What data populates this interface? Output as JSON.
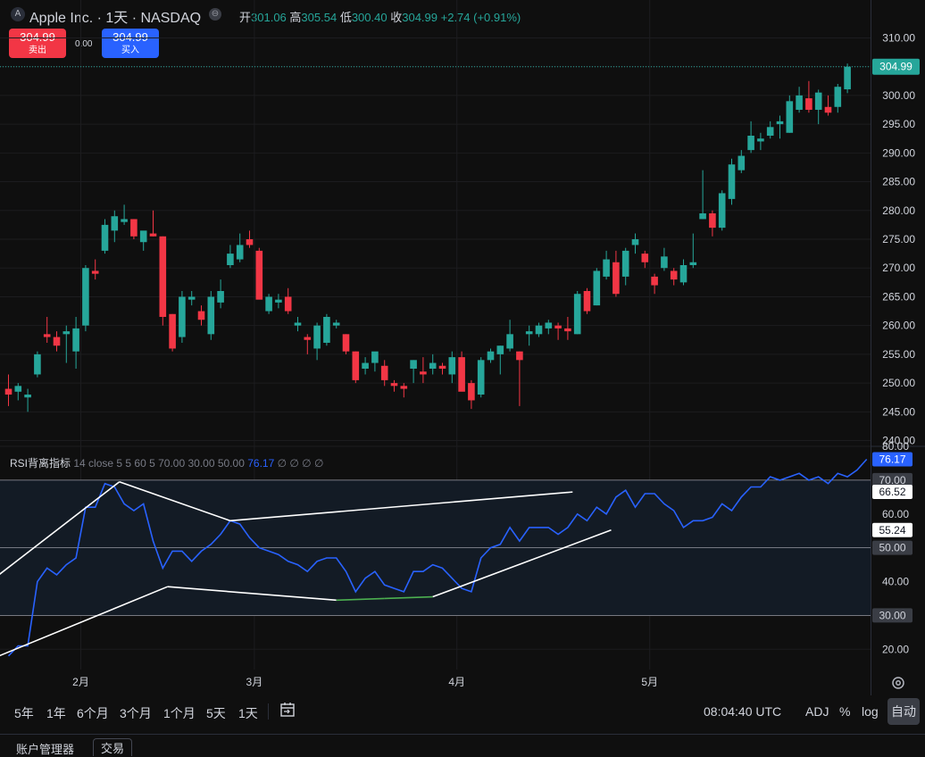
{
  "header": {
    "logo_letter": "A",
    "symbol": "Apple Inc. · 1天 · NASDAQ",
    "open_label": "开",
    "open_value": "301.06",
    "high_label": "高",
    "high_value": "305.54",
    "low_label": "低",
    "low_value": "300.40",
    "close_label": "收",
    "close_value": "304.99",
    "change": "+2.74 (+0.91%)"
  },
  "trade": {
    "sell_price": "304.99",
    "sell_label": "卖出",
    "buy_price": "304.99",
    "buy_label": "买入",
    "spread": "0.00"
  },
  "indicator": {
    "name": "RSI背离指标",
    "params": "14 close 5 5 60 5",
    "values": "70.00  30.00  50.00",
    "current": "76.17",
    "extras": "∅ ∅ ∅ ∅"
  },
  "colors": {
    "up": "#26a69a",
    "down": "#f23645",
    "rsi_line": "#2962ff",
    "divergence": "#ffffff",
    "divergence_green": "#4caf50"
  },
  "bottom_bar": {
    "timeframes": [
      "5年",
      "1年",
      "6个月",
      "3个月",
      "1个月",
      "5天",
      "1天"
    ],
    "time": "08:04:40 UTC",
    "adj": "ADJ",
    "percent": "%",
    "log": "log",
    "auto": "自动"
  },
  "tabs": [
    "账户管理器",
    "交易"
  ],
  "chart_data": [
    {
      "type": "candlestick",
      "ylim": [
        239,
        311
      ],
      "y_ticks": [
        240,
        245,
        250,
        255,
        260,
        265,
        270,
        275,
        280,
        285,
        290,
        295,
        300,
        305,
        310
      ],
      "y_tick_labels": [
        "240.00",
        "245.00",
        "250.00",
        "255.00",
        "260.00",
        "265.00",
        "270.00",
        "275.00",
        "280.00",
        "285.00",
        "290.00",
        "295.00",
        "300.00",
        "305.00",
        "310.00"
      ],
      "x_labels": [
        "2月",
        "3月",
        "4月",
        "5月"
      ],
      "x_label_index": [
        7.5,
        25.5,
        46.5,
        66.5
      ],
      "last_price_label": "304.99",
      "candles": [
        {
          "o": 249.0,
          "h": 251.5,
          "l": 246.0,
          "c": 248.0
        },
        {
          "o": 248.5,
          "h": 250.0,
          "l": 247.0,
          "c": 249.5
        },
        {
          "o": 247.5,
          "h": 249.0,
          "l": 245.0,
          "c": 248.0
        },
        {
          "o": 251.5,
          "h": 255.5,
          "l": 251.0,
          "c": 255.0
        },
        {
          "o": 258.5,
          "h": 261.5,
          "l": 257.0,
          "c": 258.0
        },
        {
          "o": 258.0,
          "h": 259.0,
          "l": 255.5,
          "c": 256.5
        },
        {
          "o": 258.5,
          "h": 260.0,
          "l": 253.5,
          "c": 259.0
        },
        {
          "o": 255.5,
          "h": 261.5,
          "l": 252.5,
          "c": 259.5
        },
        {
          "o": 260.0,
          "h": 270.5,
          "l": 259.0,
          "c": 270.0
        },
        {
          "o": 269.5,
          "h": 271.5,
          "l": 268.0,
          "c": 269.0
        },
        {
          "o": 273.0,
          "h": 278.5,
          "l": 272.5,
          "c": 277.5
        },
        {
          "o": 276.5,
          "h": 280.0,
          "l": 274.5,
          "c": 279.0
        },
        {
          "o": 278.0,
          "h": 281.0,
          "l": 277.5,
          "c": 278.5
        },
        {
          "o": 278.5,
          "h": 278.5,
          "l": 275.0,
          "c": 275.5
        },
        {
          "o": 274.5,
          "h": 276.0,
          "l": 273.0,
          "c": 276.5
        },
        {
          "o": 276.0,
          "h": 280.0,
          "l": 275.5,
          "c": 275.5
        },
        {
          "o": 275.5,
          "h": 275.5,
          "l": 260.0,
          "c": 261.5
        },
        {
          "o": 262.0,
          "h": 262.0,
          "l": 255.5,
          "c": 256.0
        },
        {
          "o": 258.0,
          "h": 266.0,
          "l": 257.0,
          "c": 265.0
        },
        {
          "o": 264.5,
          "h": 266.0,
          "l": 263.5,
          "c": 265.0
        },
        {
          "o": 262.5,
          "h": 263.5,
          "l": 260.0,
          "c": 261.0
        },
        {
          "o": 258.5,
          "h": 266.0,
          "l": 257.5,
          "c": 265.0
        },
        {
          "o": 264.0,
          "h": 268.0,
          "l": 263.0,
          "c": 266.0
        },
        {
          "o": 270.5,
          "h": 274.0,
          "l": 270.0,
          "c": 272.5
        },
        {
          "o": 271.5,
          "h": 276.0,
          "l": 271.0,
          "c": 274.0
        },
        {
          "o": 275.0,
          "h": 276.5,
          "l": 273.5,
          "c": 274.0
        },
        {
          "o": 273.0,
          "h": 273.5,
          "l": 265.0,
          "c": 264.5
        },
        {
          "o": 262.5,
          "h": 265.5,
          "l": 262.0,
          "c": 265.0
        },
        {
          "o": 264.0,
          "h": 265.5,
          "l": 263.0,
          "c": 264.5
        },
        {
          "o": 265.0,
          "h": 266.5,
          "l": 262.0,
          "c": 262.5
        },
        {
          "o": 260.0,
          "h": 261.5,
          "l": 259.0,
          "c": 260.5
        },
        {
          "o": 258.0,
          "h": 258.5,
          "l": 255.0,
          "c": 257.5
        },
        {
          "o": 256.0,
          "h": 260.5,
          "l": 254.0,
          "c": 260.0
        },
        {
          "o": 257.0,
          "h": 262.0,
          "l": 256.5,
          "c": 261.5
        },
        {
          "o": 260.0,
          "h": 261.0,
          "l": 259.5,
          "c": 260.5
        },
        {
          "o": 258.5,
          "h": 258.5,
          "l": 255.0,
          "c": 255.5
        },
        {
          "o": 255.5,
          "h": 255.5,
          "l": 250.0,
          "c": 250.5
        },
        {
          "o": 252.5,
          "h": 254.5,
          "l": 251.5,
          "c": 253.5
        },
        {
          "o": 253.5,
          "h": 254.5,
          "l": 252.0,
          "c": 255.5
        },
        {
          "o": 253.0,
          "h": 254.0,
          "l": 249.5,
          "c": 250.5
        },
        {
          "o": 250.0,
          "h": 250.5,
          "l": 248.5,
          "c": 249.5
        },
        {
          "o": 249.5,
          "h": 250.0,
          "l": 247.5,
          "c": 249.0
        },
        {
          "o": 252.5,
          "h": 254.0,
          "l": 250.0,
          "c": 254.0
        },
        {
          "o": 252.0,
          "h": 254.5,
          "l": 250.0,
          "c": 251.5
        },
        {
          "o": 252.5,
          "h": 255.0,
          "l": 251.5,
          "c": 253.5
        },
        {
          "o": 253.0,
          "h": 253.5,
          "l": 251.5,
          "c": 252.5
        },
        {
          "o": 251.5,
          "h": 255.5,
          "l": 250.0,
          "c": 254.5
        },
        {
          "o": 254.5,
          "h": 255.5,
          "l": 249.0,
          "c": 248.5
        },
        {
          "o": 250.0,
          "h": 250.5,
          "l": 245.5,
          "c": 247.0
        },
        {
          "o": 248.0,
          "h": 254.5,
          "l": 247.5,
          "c": 254.0
        },
        {
          "o": 254.0,
          "h": 256.0,
          "l": 253.5,
          "c": 255.5
        },
        {
          "o": 255.0,
          "h": 256.5,
          "l": 251.5,
          "c": 256.5
        },
        {
          "o": 256.0,
          "h": 261.0,
          "l": 255.5,
          "c": 258.5
        },
        {
          "o": 255.5,
          "h": 255.5,
          "l": 246.0,
          "c": 254.0
        },
        {
          "o": 258.5,
          "h": 260.0,
          "l": 256.5,
          "c": 259.0
        },
        {
          "o": 258.5,
          "h": 260.5,
          "l": 258.0,
          "c": 260.0
        },
        {
          "o": 259.5,
          "h": 261.0,
          "l": 258.5,
          "c": 260.5
        },
        {
          "o": 260.0,
          "h": 260.5,
          "l": 257.5,
          "c": 259.5
        },
        {
          "o": 259.5,
          "h": 261.5,
          "l": 257.5,
          "c": 259.0
        },
        {
          "o": 258.5,
          "h": 266.0,
          "l": 258.5,
          "c": 265.5
        },
        {
          "o": 266.0,
          "h": 266.5,
          "l": 262.0,
          "c": 262.5
        },
        {
          "o": 263.5,
          "h": 270.0,
          "l": 263.5,
          "c": 269.5
        },
        {
          "o": 268.5,
          "h": 273.0,
          "l": 268.0,
          "c": 271.5
        },
        {
          "o": 271.0,
          "h": 273.0,
          "l": 265.0,
          "c": 265.5
        },
        {
          "o": 268.5,
          "h": 273.5,
          "l": 267.0,
          "c": 273.0
        },
        {
          "o": 274.0,
          "h": 276.0,
          "l": 272.5,
          "c": 275.0
        },
        {
          "o": 272.5,
          "h": 273.0,
          "l": 270.0,
          "c": 271.0
        },
        {
          "o": 268.5,
          "h": 269.0,
          "l": 265.5,
          "c": 267.0
        },
        {
          "o": 270.0,
          "h": 273.5,
          "l": 269.5,
          "c": 272.0
        },
        {
          "o": 269.5,
          "h": 270.0,
          "l": 267.0,
          "c": 268.0
        },
        {
          "o": 267.5,
          "h": 271.5,
          "l": 267.0,
          "c": 270.5
        },
        {
          "o": 270.5,
          "h": 276.0,
          "l": 270.0,
          "c": 271.0
        },
        {
          "o": 278.5,
          "h": 287.0,
          "l": 278.5,
          "c": 279.5
        },
        {
          "o": 279.5,
          "h": 280.0,
          "l": 275.5,
          "c": 277.0
        },
        {
          "o": 277.0,
          "h": 283.5,
          "l": 276.5,
          "c": 283.0
        },
        {
          "o": 282.0,
          "h": 289.0,
          "l": 281.0,
          "c": 288.0
        },
        {
          "o": 287.0,
          "h": 290.5,
          "l": 286.5,
          "c": 289.5
        },
        {
          "o": 290.5,
          "h": 295.5,
          "l": 290.0,
          "c": 293.0
        },
        {
          "o": 292.0,
          "h": 293.5,
          "l": 290.5,
          "c": 292.5
        },
        {
          "o": 293.0,
          "h": 295.5,
          "l": 292.5,
          "c": 294.5
        },
        {
          "o": 295.0,
          "h": 296.5,
          "l": 292.5,
          "c": 295.5
        },
        {
          "o": 293.5,
          "h": 300.0,
          "l": 293.5,
          "c": 299.0
        },
        {
          "o": 297.5,
          "h": 301.5,
          "l": 297.0,
          "c": 300.0
        },
        {
          "o": 299.5,
          "h": 302.5,
          "l": 297.0,
          "c": 297.5
        },
        {
          "o": 297.5,
          "h": 301.0,
          "l": 295.0,
          "c": 300.5
        },
        {
          "o": 298.0,
          "h": 300.0,
          "l": 296.5,
          "c": 297.0
        },
        {
          "o": 298.0,
          "h": 302.0,
          "l": 297.0,
          "c": 301.5
        },
        {
          "o": 301.06,
          "h": 305.54,
          "l": 300.4,
          "c": 304.99
        }
      ]
    },
    {
      "type": "line",
      "ylim": [
        14,
        80
      ],
      "y_ticks": [
        20,
        30,
        40,
        50,
        60,
        70,
        80
      ],
      "y_tick_labels": [
        "20.00",
        "30.00",
        "40.00",
        "50.00",
        "60.00",
        "70.00",
        "80.00"
      ],
      "bands": [
        30,
        50,
        70
      ],
      "price_labels": [
        "76.17",
        "70.00",
        "66.52",
        "55.24",
        "50.00",
        "30.00"
      ],
      "price_label_values": [
        76.17,
        70,
        66.52,
        55.24,
        50,
        30
      ],
      "series": [
        {
          "values": [
            18,
            21,
            21,
            40,
            44,
            42,
            45,
            47,
            62,
            62,
            69,
            68,
            63,
            61,
            63,
            52,
            44,
            49,
            49,
            46,
            49,
            51,
            54,
            58,
            57,
            53,
            50,
            49,
            48,
            46,
            45,
            43,
            46,
            47,
            47,
            43,
            37,
            41,
            43,
            39,
            38,
            37,
            43,
            43,
            45,
            44,
            41,
            38,
            37,
            47,
            50,
            51,
            56,
            52,
            56,
            56,
            56,
            54,
            56,
            60,
            58,
            62,
            60,
            65,
            67,
            62,
            66,
            66,
            63,
            61,
            56,
            58,
            58,
            59,
            63,
            61,
            65,
            68,
            68,
            71,
            70,
            71,
            72,
            70,
            71,
            69,
            72,
            71,
            73,
            76.17
          ]
        }
      ],
      "divergences": [
        {
          "from": [
            -1,
            42
          ],
          "to": [
            11.5,
            69.5
          ],
          "color": "white"
        },
        {
          "from": [
            -1,
            18
          ],
          "to": [
            16.5,
            38.5
          ],
          "color": "white"
        },
        {
          "from": [
            11.5,
            69.5
          ],
          "to": [
            23,
            58
          ],
          "color": "white"
        },
        {
          "from": [
            23,
            58
          ],
          "to": [
            58.5,
            66.5
          ],
          "color": "white"
        },
        {
          "from": [
            16.5,
            38.5
          ],
          "to": [
            34,
            34.5
          ],
          "color": "white"
        },
        {
          "from": [
            34,
            34.5
          ],
          "to": [
            39,
            35
          ],
          "color": "green"
        },
        {
          "from": [
            39,
            35
          ],
          "to": [
            44,
            35.5
          ],
          "color": "green"
        },
        {
          "from": [
            44,
            35.5
          ],
          "to": [
            62.5,
            55.24
          ],
          "color": "white"
        }
      ]
    }
  ]
}
